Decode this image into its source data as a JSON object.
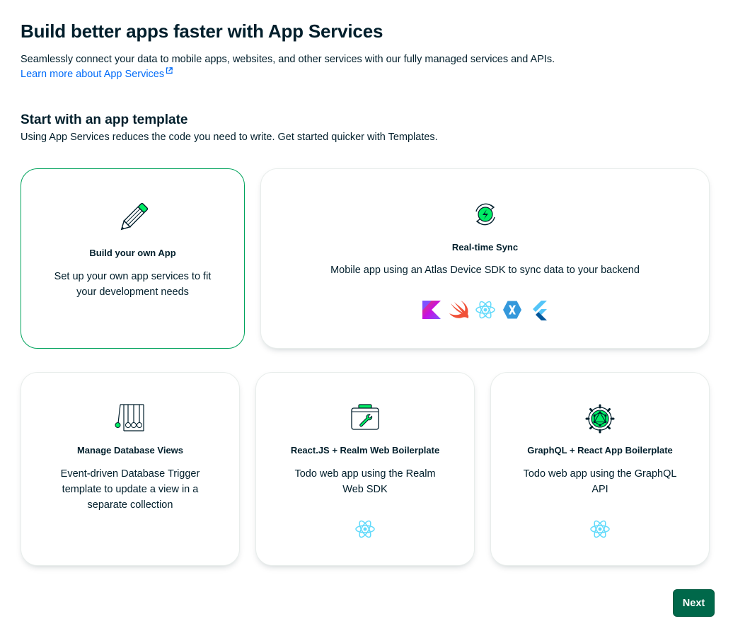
{
  "header": {
    "title": "Build better apps faster with App Services",
    "subtitle": "Seamlessly connect your data to mobile apps, websites, and other services with our fully managed services and APIs.",
    "learn_more": "Learn more about App Services"
  },
  "section": {
    "title": "Start with an app template",
    "subtitle": "Using App Services reduces the code you need to write. Get started quicker with Templates."
  },
  "cards": [
    {
      "title": "Build your own App",
      "description": "Set up your own app services to fit your development needs",
      "icon": "pencil-icon",
      "selected": true
    },
    {
      "title": "Real-time Sync",
      "description": "Mobile app using an Atlas Device SDK to sync data to your backend",
      "icon": "sync-icon",
      "sdk_icons": [
        "kotlin-icon",
        "swift-icon",
        "react-icon",
        "xamarin-icon",
        "flutter-icon"
      ]
    },
    {
      "title": "Manage Database Views",
      "description": "Event-driven Database Trigger template to update a view in a separate collection",
      "icon": "newtons-cradle-icon"
    },
    {
      "title": "React.JS + Realm Web Boilerplate",
      "description": "Todo web app using the Realm Web SDK",
      "icon": "toolbox-icon",
      "sdk_icons": [
        "react-icon"
      ]
    },
    {
      "title": "GraphQL + React App Boilerplate",
      "description": "Todo web app using the GraphQL API",
      "icon": "graphql-gear-icon",
      "sdk_icons": [
        "react-icon"
      ]
    }
  ],
  "footer": {
    "next_label": "Next"
  },
  "colors": {
    "accent_green": "#00684a",
    "selected_border": "#00a35c",
    "link_blue": "#016bf8",
    "text": "#001e2b"
  }
}
